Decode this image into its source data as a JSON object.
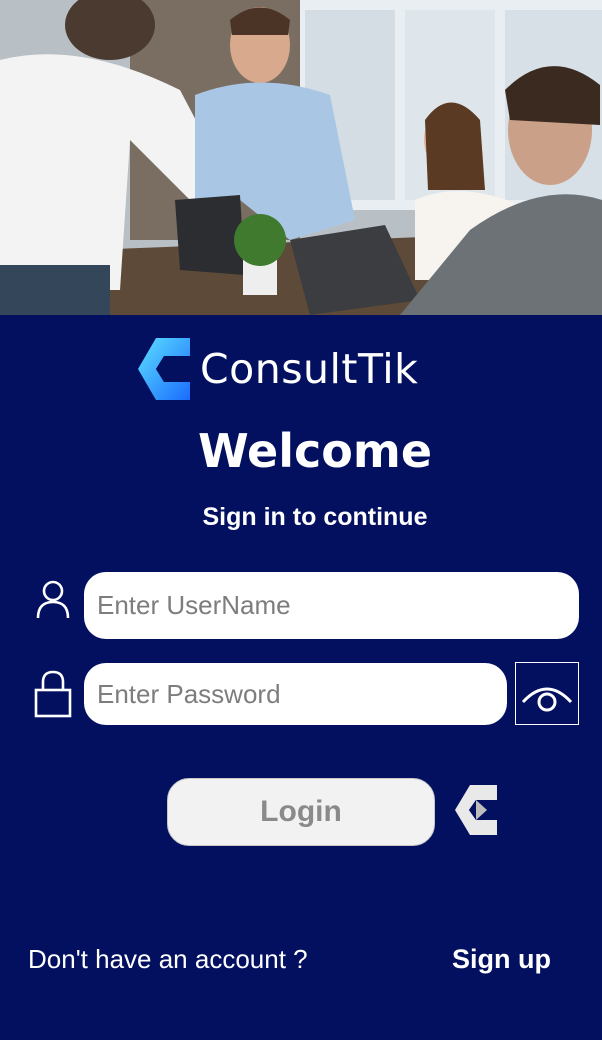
{
  "brand": {
    "name": "ConsultTik",
    "accent": "#1fa3ff",
    "background": "#031060"
  },
  "hero": {
    "icon": "meeting-photo"
  },
  "heading": {
    "title": "Welcome",
    "subtitle": "Sign in to continue"
  },
  "form": {
    "username": {
      "placeholder": "Enter UserName",
      "value": "",
      "icon": "user-icon"
    },
    "password": {
      "placeholder": "Enter Password",
      "value": "",
      "icon": "lock-icon",
      "toggle_icon": "eye-icon"
    },
    "login_label": "Login"
  },
  "footer": {
    "prompt": "Don't have an account ?",
    "signup_label": "Sign up"
  }
}
